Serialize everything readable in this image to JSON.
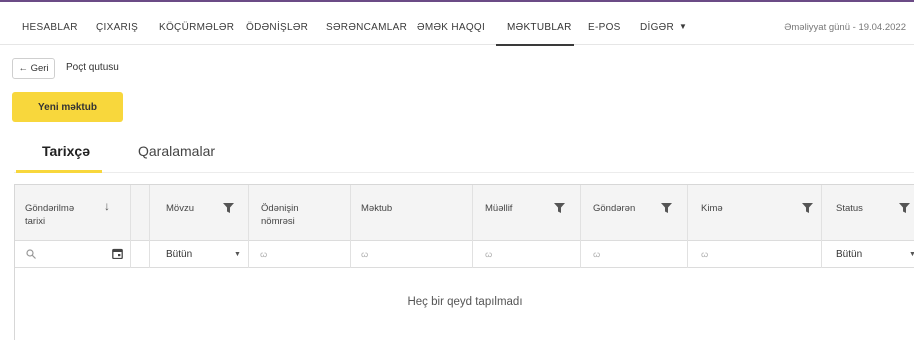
{
  "nav": {
    "items": [
      "HESABLAR",
      "ÇIXARIŞ",
      "KÖÇÜRMƏLƏR",
      "ÖDƏNİŞLƏR",
      "SƏRƏNCAMLAR",
      "ƏMƏK HAQQI",
      "MƏKTUBLAR",
      "E-POS",
      "DİGƏR"
    ],
    "active": "MƏKTUBLAR",
    "operation_day": "Əməliyyat günü - 19.04.2022"
  },
  "breadcrumb": {
    "back_label": "← Geri",
    "current": "Poçt qutusu"
  },
  "actions": {
    "new_letter": "Yeni məktub"
  },
  "tabs": {
    "history": "Tarixçə",
    "drafts": "Qaralamalar",
    "active": "Tarixçə"
  },
  "grid": {
    "columns": {
      "sent_date": "Göndərilmə tarixi",
      "subject": "Mövzu",
      "payment_number": "Ödənişin nömrəsi",
      "letter": "Məktub",
      "author": "Müəllif",
      "sender": "Göndərən",
      "recipient": "Kimə",
      "status": "Status"
    },
    "filters": {
      "subject": "Bütün",
      "status": "Bütün"
    },
    "empty_message": "Heç bir qeyd tapılmadı"
  },
  "colors": {
    "accent_yellow": "#f8d73c",
    "brand_purple": "#6b4b86"
  }
}
